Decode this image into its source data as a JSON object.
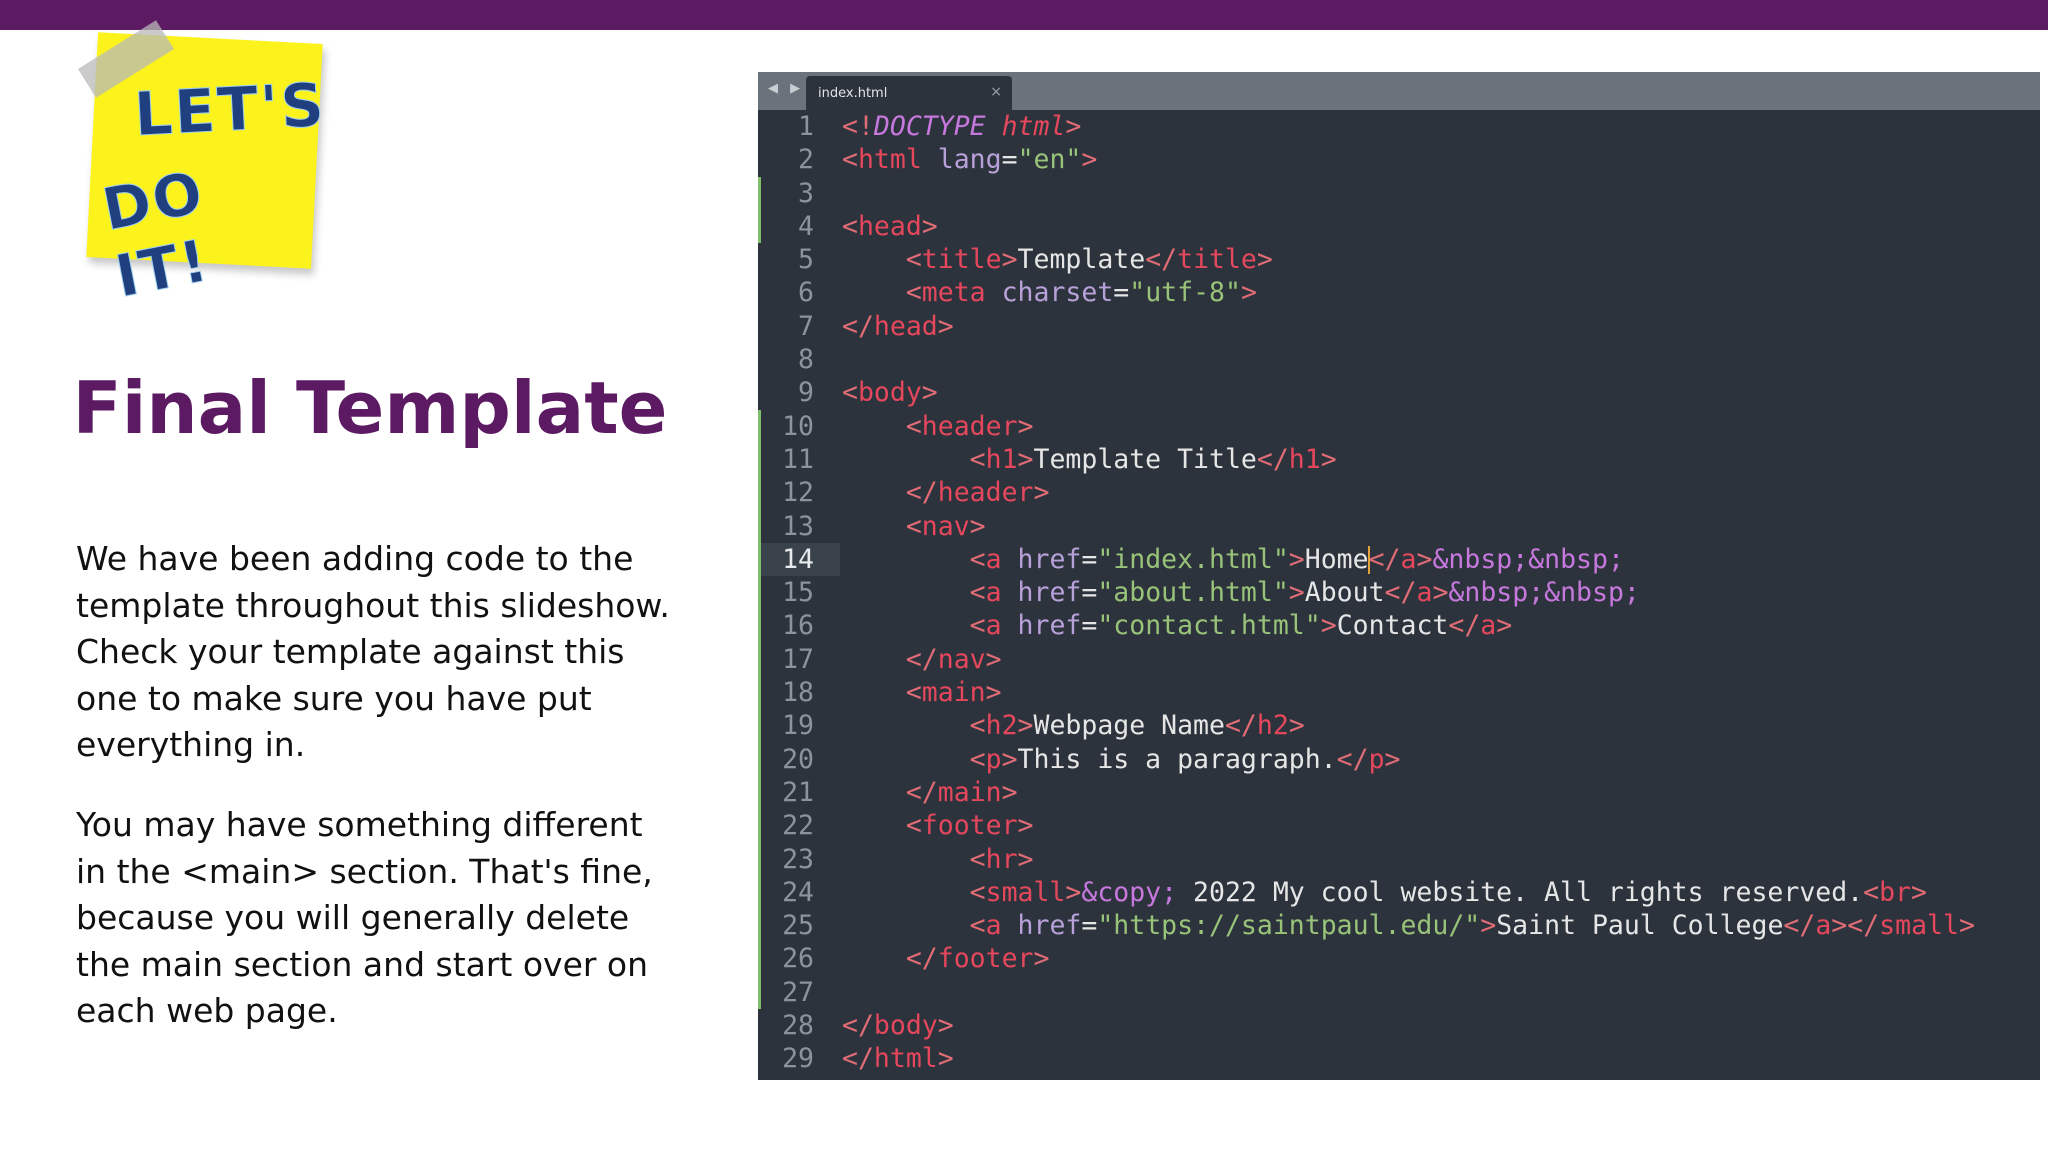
{
  "sticky": {
    "line1": "LET'S",
    "line2": "DO IT!"
  },
  "title": "Final Template",
  "paragraphs": [
    "We have been adding code to the template throughout this slideshow. Check your template against this one to make sure you have put everything in.",
    "You may have something different in the <main> section. That's fine, because you will generally delete the main section and start over on each web page."
  ],
  "editor": {
    "nav_arrows": "◀ ▶",
    "tab_label": "index.html",
    "tab_close": "×",
    "active_line": 14,
    "lines": [
      {
        "n": "1",
        "code": [
          [
            "p",
            "<!"
          ],
          [
            "d",
            "DOCTYPE"
          ],
          [
            "w",
            " "
          ],
          [
            "dh",
            "html"
          ],
          [
            "p",
            ">"
          ]
        ]
      },
      {
        "n": "2",
        "code": [
          [
            "p",
            "<"
          ],
          [
            "t",
            "html"
          ],
          [
            "w",
            " "
          ],
          [
            "a",
            "lang"
          ],
          [
            "w",
            "="
          ],
          [
            "s",
            "\"en\""
          ],
          [
            "p",
            ">"
          ]
        ]
      },
      {
        "n": "3",
        "code": []
      },
      {
        "n": "4",
        "code": [
          [
            "p",
            "<"
          ],
          [
            "t",
            "head"
          ],
          [
            "p",
            ">"
          ]
        ]
      },
      {
        "n": "5",
        "code": [
          [
            "w",
            "    "
          ],
          [
            "p",
            "<"
          ],
          [
            "t",
            "title"
          ],
          [
            "p",
            ">"
          ],
          [
            "w",
            "Template"
          ],
          [
            "p",
            "</"
          ],
          [
            "t",
            "title"
          ],
          [
            "p",
            ">"
          ]
        ]
      },
      {
        "n": "6",
        "code": [
          [
            "w",
            "    "
          ],
          [
            "p",
            "<"
          ],
          [
            "t",
            "meta"
          ],
          [
            "w",
            " "
          ],
          [
            "a",
            "charset"
          ],
          [
            "w",
            "="
          ],
          [
            "s",
            "\"utf-8\""
          ],
          [
            "p",
            ">"
          ]
        ]
      },
      {
        "n": "7",
        "code": [
          [
            "p",
            "</"
          ],
          [
            "t",
            "head"
          ],
          [
            "p",
            ">"
          ]
        ]
      },
      {
        "n": "8",
        "code": []
      },
      {
        "n": "9",
        "code": [
          [
            "p",
            "<"
          ],
          [
            "t",
            "body"
          ],
          [
            "p",
            ">"
          ]
        ]
      },
      {
        "n": "10",
        "code": [
          [
            "w",
            "    "
          ],
          [
            "p",
            "<"
          ],
          [
            "t",
            "header"
          ],
          [
            "p",
            ">"
          ]
        ]
      },
      {
        "n": "11",
        "code": [
          [
            "w",
            "        "
          ],
          [
            "p",
            "<"
          ],
          [
            "t",
            "h1"
          ],
          [
            "p",
            ">"
          ],
          [
            "w",
            "Template Title"
          ],
          [
            "p",
            "</"
          ],
          [
            "t",
            "h1"
          ],
          [
            "p",
            ">"
          ]
        ]
      },
      {
        "n": "12",
        "code": [
          [
            "w",
            "    "
          ],
          [
            "p",
            "</"
          ],
          [
            "t",
            "header"
          ],
          [
            "p",
            ">"
          ]
        ]
      },
      {
        "n": "13",
        "code": [
          [
            "w",
            "    "
          ],
          [
            "p",
            "<"
          ],
          [
            "t",
            "nav"
          ],
          [
            "p",
            ">"
          ]
        ]
      },
      {
        "n": "14",
        "code": [
          [
            "w",
            "        "
          ],
          [
            "p",
            "<"
          ],
          [
            "t",
            "a"
          ],
          [
            "w",
            " "
          ],
          [
            "a",
            "href"
          ],
          [
            "w",
            "="
          ],
          [
            "s",
            "\"index.html\""
          ],
          [
            "p",
            ">"
          ],
          [
            "w",
            "Home"
          ],
          [
            "cursor",
            ""
          ],
          [
            "p",
            "</"
          ],
          [
            "t",
            "a"
          ],
          [
            "p",
            ">"
          ],
          [
            "e",
            "&nbsp;&nbsp;"
          ]
        ]
      },
      {
        "n": "15",
        "code": [
          [
            "w",
            "        "
          ],
          [
            "p",
            "<"
          ],
          [
            "t",
            "a"
          ],
          [
            "w",
            " "
          ],
          [
            "a",
            "href"
          ],
          [
            "w",
            "="
          ],
          [
            "s",
            "\"about.html\""
          ],
          [
            "p",
            ">"
          ],
          [
            "w",
            "About"
          ],
          [
            "p",
            "</"
          ],
          [
            "t",
            "a"
          ],
          [
            "p",
            ">"
          ],
          [
            "e",
            "&nbsp;&nbsp;"
          ]
        ]
      },
      {
        "n": "16",
        "code": [
          [
            "w",
            "        "
          ],
          [
            "p",
            "<"
          ],
          [
            "t",
            "a"
          ],
          [
            "w",
            " "
          ],
          [
            "a",
            "href"
          ],
          [
            "w",
            "="
          ],
          [
            "s",
            "\"contact.html\""
          ],
          [
            "p",
            ">"
          ],
          [
            "w",
            "Contact"
          ],
          [
            "p",
            "</"
          ],
          [
            "t",
            "a"
          ],
          [
            "p",
            ">"
          ]
        ]
      },
      {
        "n": "17",
        "code": [
          [
            "w",
            "    "
          ],
          [
            "p",
            "</"
          ],
          [
            "t",
            "nav"
          ],
          [
            "p",
            ">"
          ]
        ]
      },
      {
        "n": "18",
        "code": [
          [
            "w",
            "    "
          ],
          [
            "p",
            "<"
          ],
          [
            "t",
            "main"
          ],
          [
            "p",
            ">"
          ]
        ]
      },
      {
        "n": "19",
        "code": [
          [
            "w",
            "        "
          ],
          [
            "p",
            "<"
          ],
          [
            "t",
            "h2"
          ],
          [
            "p",
            ">"
          ],
          [
            "w",
            "Webpage Name"
          ],
          [
            "p",
            "</"
          ],
          [
            "t",
            "h2"
          ],
          [
            "p",
            ">"
          ]
        ]
      },
      {
        "n": "20",
        "code": [
          [
            "w",
            "        "
          ],
          [
            "p",
            "<"
          ],
          [
            "t",
            "p"
          ],
          [
            "p",
            ">"
          ],
          [
            "w",
            "This is a paragraph."
          ],
          [
            "p",
            "</"
          ],
          [
            "t",
            "p"
          ],
          [
            "p",
            ">"
          ]
        ]
      },
      {
        "n": "21",
        "code": [
          [
            "w",
            "    "
          ],
          [
            "p",
            "</"
          ],
          [
            "t",
            "main"
          ],
          [
            "p",
            ">"
          ]
        ]
      },
      {
        "n": "22",
        "code": [
          [
            "w",
            "    "
          ],
          [
            "p",
            "<"
          ],
          [
            "t",
            "footer"
          ],
          [
            "p",
            ">"
          ]
        ]
      },
      {
        "n": "23",
        "code": [
          [
            "w",
            "        "
          ],
          [
            "p",
            "<"
          ],
          [
            "t",
            "hr"
          ],
          [
            "p",
            ">"
          ]
        ]
      },
      {
        "n": "24",
        "code": [
          [
            "w",
            "        "
          ],
          [
            "p",
            "<"
          ],
          [
            "t",
            "small"
          ],
          [
            "p",
            ">"
          ],
          [
            "e",
            "&copy;"
          ],
          [
            "w",
            " 2022 My cool website. All rights reserved."
          ],
          [
            "p",
            "<"
          ],
          [
            "t",
            "br"
          ],
          [
            "p",
            ">"
          ]
        ]
      },
      {
        "n": "25",
        "code": [
          [
            "w",
            "        "
          ],
          [
            "p",
            "<"
          ],
          [
            "t",
            "a"
          ],
          [
            "w",
            " "
          ],
          [
            "a",
            "href"
          ],
          [
            "w",
            "="
          ],
          [
            "s",
            "\"https://saintpaul.edu/\""
          ],
          [
            "p",
            ">"
          ],
          [
            "w",
            "Saint Paul College"
          ],
          [
            "p",
            "</"
          ],
          [
            "t",
            "a"
          ],
          [
            "p",
            "></"
          ],
          [
            "t",
            "small"
          ],
          [
            "p",
            ">"
          ]
        ]
      },
      {
        "n": "26",
        "code": [
          [
            "w",
            "    "
          ],
          [
            "p",
            "</"
          ],
          [
            "t",
            "footer"
          ],
          [
            "p",
            ">"
          ]
        ]
      },
      {
        "n": "27",
        "code": []
      },
      {
        "n": "28",
        "code": [
          [
            "p",
            "</"
          ],
          [
            "t",
            "body"
          ],
          [
            "p",
            ">"
          ]
        ]
      },
      {
        "n": "29",
        "code": [
          [
            "p",
            "</"
          ],
          [
            "t",
            "html"
          ],
          [
            "p",
            ">"
          ]
        ]
      }
    ]
  },
  "colors": {
    "brand_purple": "#5b1a62",
    "sticky_yellow": "#fbf31b",
    "editor_bg": "#2c333c"
  }
}
